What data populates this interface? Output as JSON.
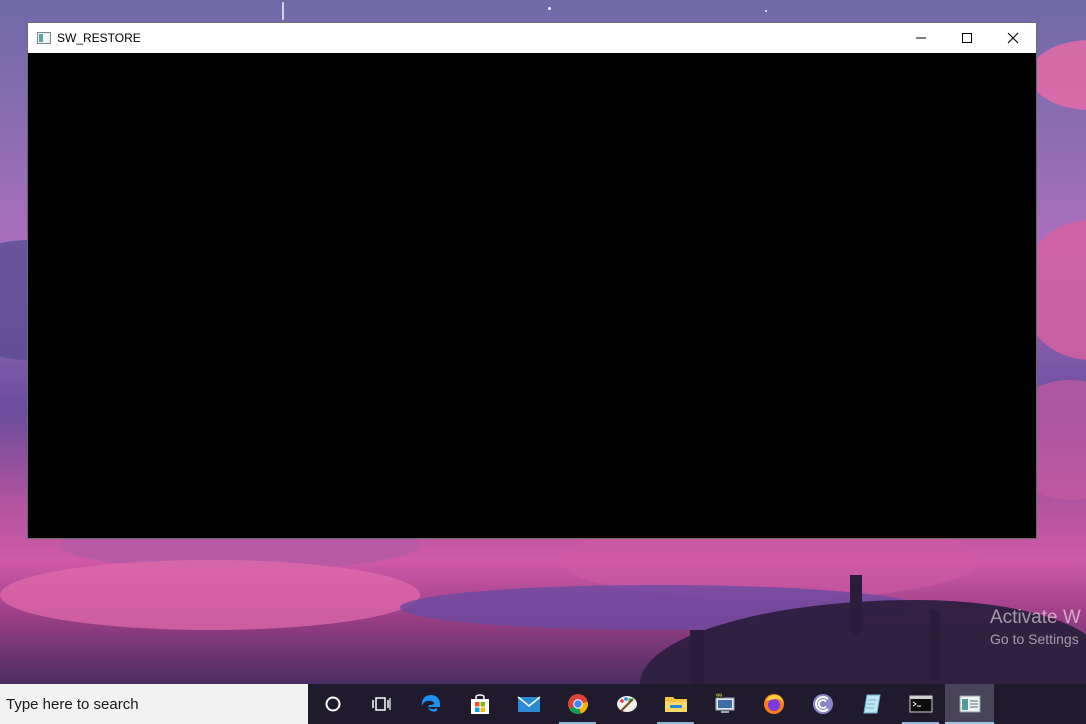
{
  "window": {
    "title": "SW_RESTORE",
    "controls": [
      "minimize-icon",
      "maximize-icon",
      "close-icon"
    ]
  },
  "watermark": {
    "line1": "Activate W",
    "line2": "Go to Settings"
  },
  "taskbar": {
    "search_placeholder": "Type here to search",
    "icons": [
      "cortana-icon",
      "task-view-icon",
      "edge-icon",
      "store-icon",
      "mail-icon",
      "chrome-icon",
      "paint-icon",
      "file-explorer-icon",
      "device-manager-icon",
      "firefox-icon",
      "bittorrent-icon",
      "notepad-icon",
      "command-prompt-icon",
      "sw-restore-app-icon"
    ]
  }
}
